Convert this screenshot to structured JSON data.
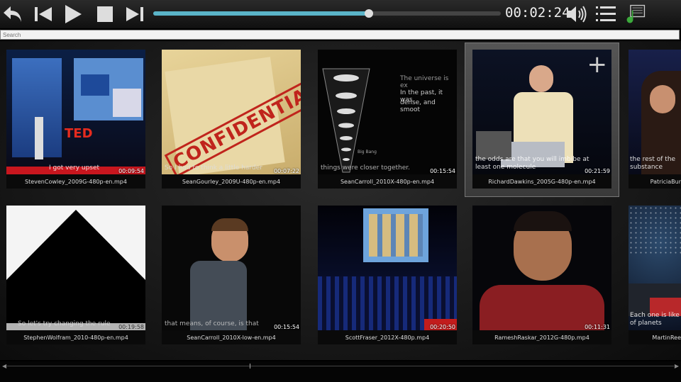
{
  "player": {
    "timecode": "00:02:24",
    "progress": 0.62
  },
  "search": {
    "placeholder": "Search"
  },
  "tiles": [
    {
      "file": "StevenCowley_2009G-480p-en.mp4",
      "duration": "00:09:54",
      "subtitle": "I got very upset"
    },
    {
      "file": "SeanGourley_2009U-480p-en.mp4",
      "duration": "00:07:22",
      "subtitle": "So I had to think a little harder"
    },
    {
      "file": "SeanCarroll_2010X-480p-en.mp4",
      "duration": "00:15:54",
      "subtitle": "things were closer together."
    },
    {
      "file": "RichardDawkins_2005G-480p-en.mp4",
      "duration": "00:21:59",
      "subtitle": "the odds are that you will imbibe at least one molecule"
    },
    {
      "file": "PatriciaBur",
      "duration": "",
      "subtitle": "the rest of the substance"
    },
    {
      "file": "StephenWolfram_2010-480p-en.mp4",
      "duration": "00:19:58",
      "subtitle": "So let's try changing the rule"
    },
    {
      "file": "SeanCarroll_2010X-low-en.mp4",
      "duration": "00:15:54",
      "subtitle": "that means, of course, is that"
    },
    {
      "file": "ScottFraser_2012X-480p.mp4",
      "duration": "00:20:50",
      "subtitle": ""
    },
    {
      "file": "RameshRaskar_2012G-480p.mp4",
      "duration": "00:11:31",
      "subtitle": ""
    },
    {
      "file": "MartinRee",
      "duration": "",
      "subtitle": "Each one is like of planets"
    }
  ],
  "thumb_text": {
    "ted": "TED",
    "confidential": "CONFIDENTIAL",
    "universe_1": "The universe is ex",
    "universe_2": "In the past, it was",
    "universe_3": "dense, and smoot",
    "big_bang": "Big Bang"
  },
  "colors": {
    "accent": "#5ab4c8",
    "toolbar": "#1a1a1a"
  }
}
